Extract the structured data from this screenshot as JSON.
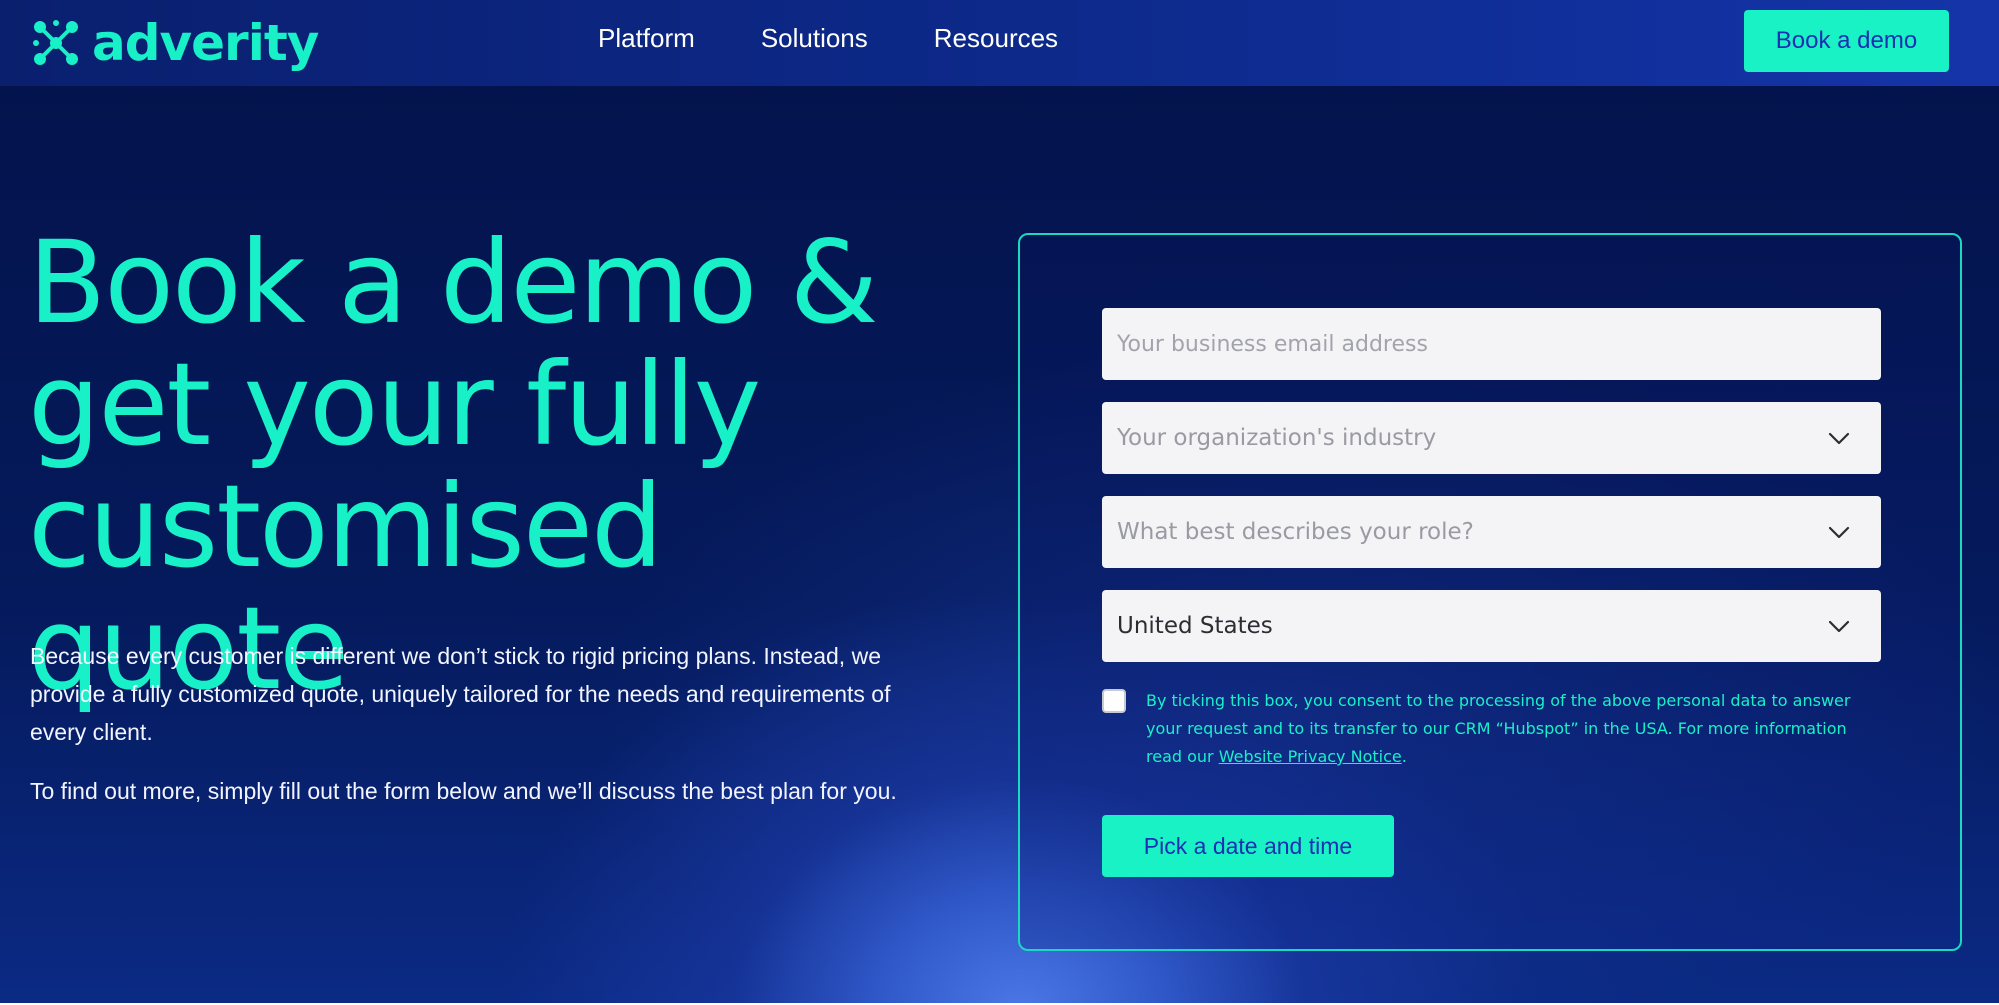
{
  "brand": {
    "name": "adverity",
    "accent": "#18f0c7",
    "navy": "#051a5c"
  },
  "nav": {
    "links": [
      "Platform",
      "Solutions",
      "Resources"
    ],
    "cta": "Book a demo"
  },
  "hero": {
    "title_lines": [
      "Book a demo &",
      "get your fully",
      "customised quote"
    ],
    "paragraph1": "Because every customer is different we don’t stick to rigid pricing plans. Instead, we provide a fully customized quote, uniquely tailored for the needs and requirements of every client.",
    "paragraph2": "To find out more, simply fill out the form below and we’ll discuss the best plan for you."
  },
  "form": {
    "email_placeholder": "Your business email address",
    "industry_placeholder": "Your organization's industry",
    "role_placeholder": "What best describes your role?",
    "country_value": "United States",
    "consent_checked": false,
    "consent_text": "By ticking this box, you consent to the processing of the above personal data to answer your request and to its transfer to our CRM “Hubspot” in the USA. For more information read our ",
    "consent_link": "Website Privacy Notice",
    "consent_end": ".",
    "submit": "Pick a date and time"
  },
  "icons": {
    "logo": "adverity-logo-mark-icon",
    "chevron": "chevron-down-icon"
  }
}
